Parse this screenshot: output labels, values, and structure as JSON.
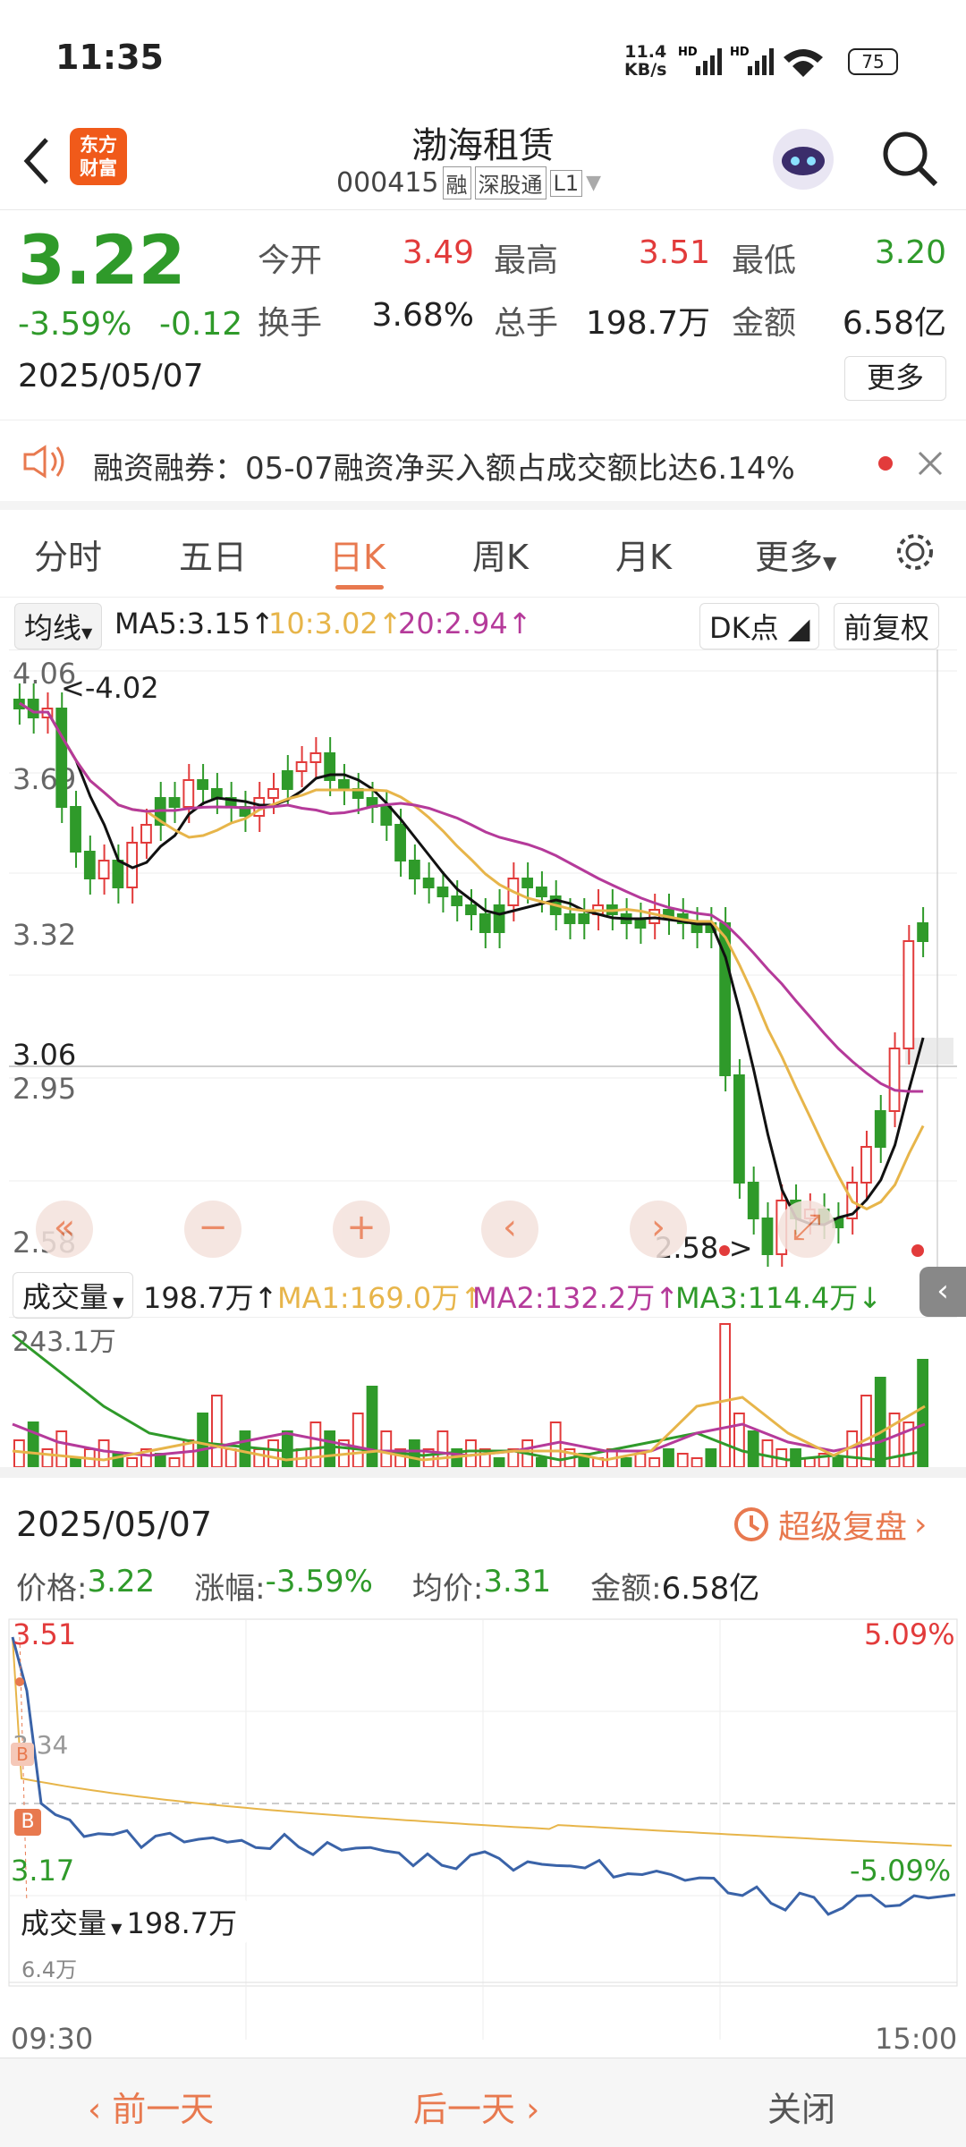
{
  "status": {
    "time": "11:35",
    "net_speed_top": "11.4",
    "net_speed_bottom": "KB/s",
    "battery": "75"
  },
  "header": {
    "stock_name": "渤海租赁",
    "stock_code": "000415",
    "tag_margin": "融",
    "tag_connect": "深股通",
    "tag_level": "L1",
    "logo_line1": "东方",
    "logo_line2": "财富"
  },
  "quote": {
    "price": "3.22",
    "change_pct": "-3.59%",
    "change": "-0.12",
    "date": "2025/05/07",
    "open_label": "今开",
    "open": "3.49",
    "high_label": "最高",
    "high": "3.51",
    "low_label": "最低",
    "low": "3.20",
    "turnover_label": "换手",
    "turnover": "3.68%",
    "volume_label": "总手",
    "volume": "198.7万",
    "amount_label": "金额",
    "amount": "6.58亿",
    "more_button": "更多"
  },
  "notice": {
    "text": "融资融券：05-07融资净买入额占成交额比达6.14%"
  },
  "tabs": [
    "分时",
    "五日",
    "日K",
    "周K",
    "月K",
    "更多"
  ],
  "active_tab": "日K",
  "ma_line": {
    "selector": "均线",
    "ma5": "MA5:3.15",
    "ma10": "10:3.02",
    "ma20": "20:2.94",
    "dk_button": "DK点",
    "adjust_button": "前复权"
  },
  "kchart": {
    "y_labels": [
      "4.06",
      "3.69",
      "3.32",
      "3.06",
      "2.95",
      "2.58"
    ],
    "high_mark": "<-4.02",
    "low_mark": "2.58->",
    "colors": {
      "up": "#e23b3b",
      "down": "#2f9a2a",
      "ma5": "#111111",
      "ma10": "#e7b54a",
      "ma20": "#b53a9a"
    }
  },
  "volume_line": {
    "selector": "成交量",
    "value": "198.7万",
    "ma1": "MA1:169.0万",
    "ma2": "MA2:132.2万",
    "ma3": "MA3:114.4万",
    "max_label": "243.1万"
  },
  "panel": {
    "date": "2025/05/07",
    "replay": "超级复盘",
    "price_label": "价格:",
    "price": "3.22",
    "chg_label": "涨幅:",
    "chg": "-3.59%",
    "avg_label": "均价:",
    "avg": "3.31",
    "amt_label": "金额:",
    "amt": "6.58亿",
    "top_price": "3.51",
    "top_pct": "5.09%",
    "mid_price": "3.34",
    "bottom_price": "3.17",
    "bottom_pct": "-5.09%",
    "vol_selector": "成交量",
    "vol_value": "198.7万",
    "vol_max": "6.4万",
    "time_start": "09:30",
    "time_end": "15:00",
    "marker": "B"
  },
  "bottom": {
    "prev": "前一天",
    "next": "后一天",
    "close": "关闭"
  },
  "icons": [
    "back-icon",
    "search-icon",
    "robot-avatar",
    "speaker-icon",
    "close-icon",
    "settings-icon",
    "history-icon"
  ]
}
